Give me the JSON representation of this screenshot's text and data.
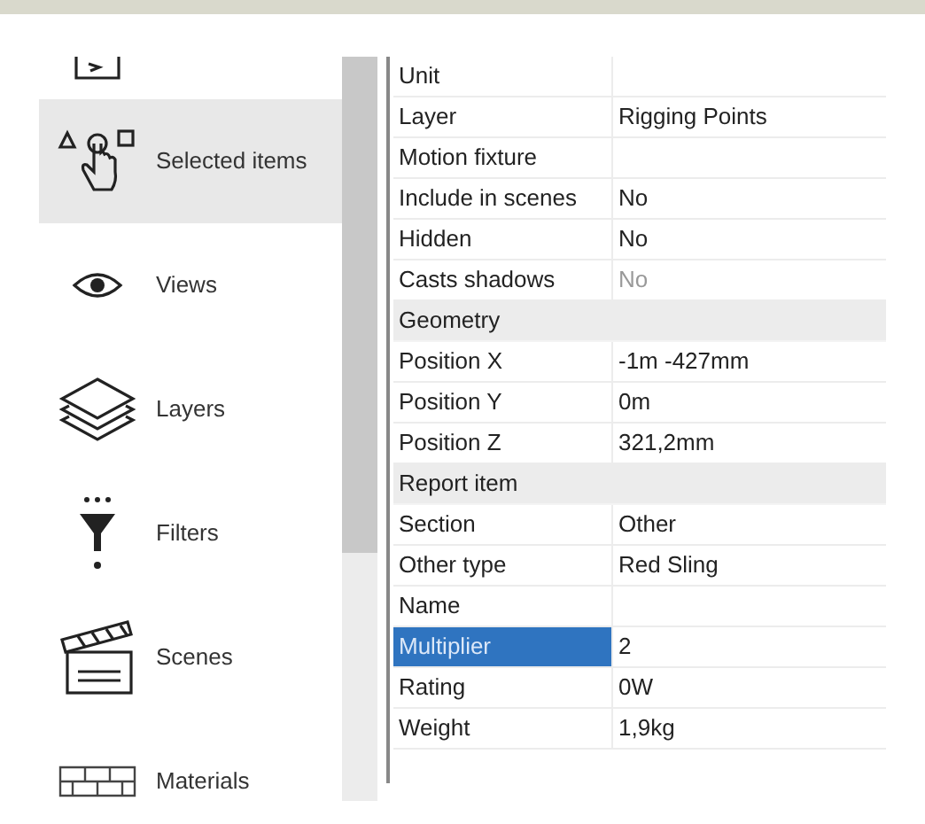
{
  "sidebar": {
    "items": [
      {
        "kind": "top",
        "selected": false
      },
      {
        "kind": "selected",
        "label": "Selected items",
        "selected": true
      },
      {
        "kind": "views",
        "label": "Views",
        "selected": false
      },
      {
        "kind": "layers",
        "label": "Layers",
        "selected": false
      },
      {
        "kind": "filters",
        "label": "Filters",
        "selected": false
      },
      {
        "kind": "scenes",
        "label": "Scenes",
        "selected": false
      },
      {
        "kind": "materials",
        "label": "Materials",
        "selected": false
      }
    ]
  },
  "properties": {
    "rows": [
      {
        "kind": "property",
        "name": "Unit",
        "selected": false
      },
      {
        "kind": "property",
        "name": "Layer",
        "value": "Rigging Points",
        "selected": false
      },
      {
        "kind": "property",
        "name": "Motion fixture",
        "selected": false
      },
      {
        "kind": "property",
        "name": "Include in scenes",
        "value": "No",
        "selected": false
      },
      {
        "kind": "property",
        "name": "Hidden",
        "value": "No",
        "selected": false
      },
      {
        "kind": "readonly",
        "name": "Casts shadows",
        "value": "No",
        "selected": false
      },
      {
        "kind": "header",
        "name": "Geometry"
      },
      {
        "kind": "property",
        "name": "Position X",
        "value": "-1m -427mm",
        "selected": false
      },
      {
        "kind": "property",
        "name": "Position Y",
        "value": "0m",
        "selected": false
      },
      {
        "kind": "property",
        "name": "Position Z",
        "value": "321,2mm",
        "selected": false
      },
      {
        "kind": "header",
        "name": "Report item"
      },
      {
        "kind": "property",
        "name": "Section",
        "value": "Other",
        "selected": false
      },
      {
        "kind": "property",
        "name": "Other type",
        "value": "Red Sling",
        "selected": false
      },
      {
        "kind": "property",
        "name": "Name",
        "selected": false
      },
      {
        "kind": "property",
        "name": "Multiplier",
        "value": "2",
        "selected": true
      },
      {
        "kind": "property",
        "name": "Rating",
        "value": "0W",
        "selected": false
      },
      {
        "kind": "property",
        "name": "Weight",
        "value": "1,9kg",
        "selected": false
      }
    ]
  }
}
